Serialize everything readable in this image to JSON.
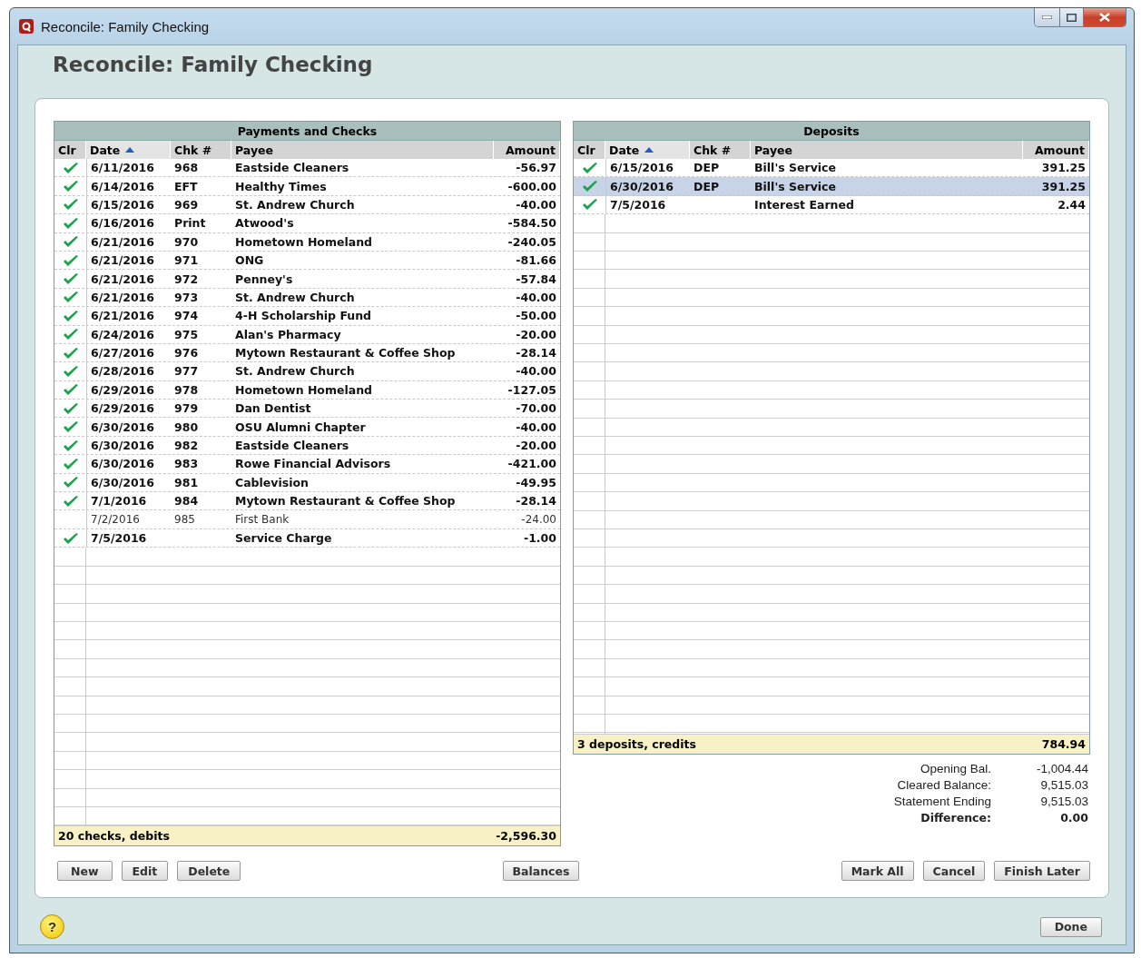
{
  "window": {
    "title": "Reconcile: Family Checking"
  },
  "heading": "Reconcile: Family Checking",
  "payments": {
    "title": "Payments and Checks",
    "columns": [
      {
        "label": "Clr",
        "sorted": false
      },
      {
        "label": "Date",
        "sorted": true
      },
      {
        "label": "Chk #",
        "sorted": false
      },
      {
        "label": "Payee",
        "sorted": false
      },
      {
        "label": "Amount",
        "sorted": false
      }
    ],
    "rows": [
      {
        "cleared": true,
        "date": "6/11/2016",
        "chk": "968",
        "payee": "Eastside Cleaners",
        "amount": "-56.97"
      },
      {
        "cleared": true,
        "date": "6/14/2016",
        "chk": "EFT",
        "payee": "Healthy Times",
        "amount": "-600.00"
      },
      {
        "cleared": true,
        "date": "6/15/2016",
        "chk": "969",
        "payee": "St. Andrew Church",
        "amount": "-40.00"
      },
      {
        "cleared": true,
        "date": "6/16/2016",
        "chk": "Print",
        "payee": "Atwood's",
        "amount": "-584.50"
      },
      {
        "cleared": true,
        "date": "6/21/2016",
        "chk": "970",
        "payee": "Hometown Homeland",
        "amount": "-240.05"
      },
      {
        "cleared": true,
        "date": "6/21/2016",
        "chk": "971",
        "payee": "ONG",
        "amount": "-81.66"
      },
      {
        "cleared": true,
        "date": "6/21/2016",
        "chk": "972",
        "payee": "Penney's",
        "amount": "-57.84"
      },
      {
        "cleared": true,
        "date": "6/21/2016",
        "chk": "973",
        "payee": "St. Andrew Church",
        "amount": "-40.00"
      },
      {
        "cleared": true,
        "date": "6/21/2016",
        "chk": "974",
        "payee": "4-H Scholarship Fund",
        "amount": "-50.00"
      },
      {
        "cleared": true,
        "date": "6/24/2016",
        "chk": "975",
        "payee": "Alan's Pharmacy",
        "amount": "-20.00"
      },
      {
        "cleared": true,
        "date": "6/27/2016",
        "chk": "976",
        "payee": "Mytown  Restaurant & Coffee Shop",
        "amount": "-28.14"
      },
      {
        "cleared": true,
        "date": "6/28/2016",
        "chk": "977",
        "payee": "St. Andrew Church",
        "amount": "-40.00"
      },
      {
        "cleared": true,
        "date": "6/29/2016",
        "chk": "978",
        "payee": "Hometown Homeland",
        "amount": "-127.05"
      },
      {
        "cleared": true,
        "date": "6/29/2016",
        "chk": "979",
        "payee": "Dan Dentist",
        "amount": "-70.00"
      },
      {
        "cleared": true,
        "date": "6/30/2016",
        "chk": "980",
        "payee": "OSU Alumni Chapter",
        "amount": "-40.00"
      },
      {
        "cleared": true,
        "date": "6/30/2016",
        "chk": "982",
        "payee": "Eastside Cleaners",
        "amount": "-20.00"
      },
      {
        "cleared": true,
        "date": "6/30/2016",
        "chk": "983",
        "payee": "Rowe Financial Advisors",
        "amount": "-421.00"
      },
      {
        "cleared": true,
        "date": "6/30/2016",
        "chk": "981",
        "payee": "Cablevision",
        "amount": "-49.95"
      },
      {
        "cleared": true,
        "date": "7/1/2016",
        "chk": "984",
        "payee": "Mytown  Restaurant & Coffee Shop",
        "amount": "-28.14"
      },
      {
        "cleared": false,
        "date": "7/2/2016",
        "chk": "985",
        "payee": "First Bank",
        "amount": "-24.00"
      },
      {
        "cleared": true,
        "date": "7/5/2016",
        "chk": "",
        "payee": "Service Charge",
        "amount": "-1.00"
      }
    ],
    "total_label": "20 checks, debits",
    "total": "-2,596.30"
  },
  "deposits": {
    "title": "Deposits",
    "columns": [
      {
        "label": "Clr",
        "sorted": false
      },
      {
        "label": "Date",
        "sorted": true
      },
      {
        "label": "Chk #",
        "sorted": false
      },
      {
        "label": "Payee",
        "sorted": false
      },
      {
        "label": "Amount",
        "sorted": false
      }
    ],
    "rows": [
      {
        "cleared": true,
        "selected": false,
        "date": "6/15/2016",
        "chk": "DEP",
        "payee": "Bill's Service",
        "amount": "391.25"
      },
      {
        "cleared": true,
        "selected": true,
        "date": "6/30/2016",
        "chk": "DEP",
        "payee": "Bill's Service",
        "amount": "391.25"
      },
      {
        "cleared": true,
        "selected": false,
        "date": "7/5/2016",
        "chk": "",
        "payee": "Interest Earned",
        "amount": "2.44"
      }
    ],
    "total_label": "3 deposits, credits",
    "total": "784.94"
  },
  "summary": [
    {
      "label": "Opening Bal.",
      "value": "-1,004.44",
      "bold": false
    },
    {
      "label": "Cleared Balance:",
      "value": "9,515.03",
      "bold": false
    },
    {
      "label": "Statement Ending",
      "value": "9,515.03",
      "bold": false
    },
    {
      "label": "Difference:",
      "value": "0.00",
      "bold": true
    }
  ],
  "left_buttons": [
    "New",
    "Edit",
    "Delete"
  ],
  "middle_button": "Balances",
  "right_buttons": [
    "Mark All",
    "Cancel",
    "Finish Later"
  ],
  "help": "?",
  "done_button": "Done"
}
